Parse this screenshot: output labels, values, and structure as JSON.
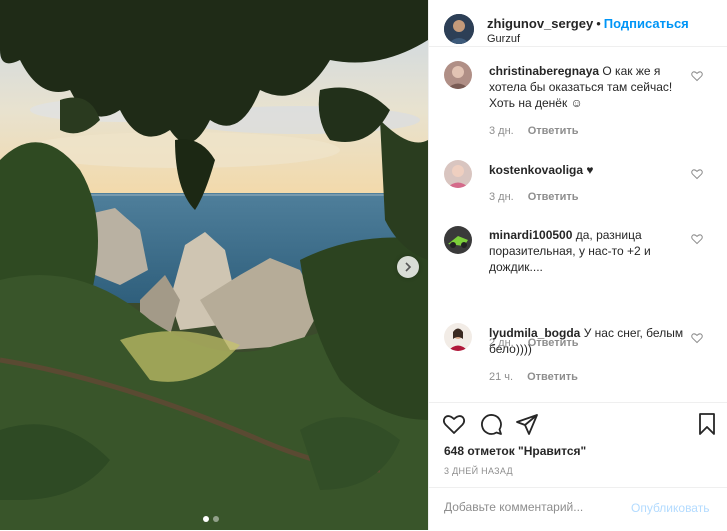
{
  "header": {
    "username": "zhigunov_sergey",
    "separator": "•",
    "follow_label": "Подписаться",
    "location": "Gurzuf",
    "avatar_icon": "user-avatar-icon"
  },
  "comments": [
    {
      "username": "christinaberegnaya",
      "text": "О как же я хотела бы оказаться там сейчас! Хоть на денёк ☺",
      "time": "3 дн.",
      "reply_label": "Ответить"
    },
    {
      "username": "kostenkovaoliga",
      "text": "♥",
      "time": "3 дн.",
      "reply_label": "Ответить"
    },
    {
      "username": "minardi100500",
      "text": "да, разница поразительная, у нас-то +2 и дождик....",
      "time": "2 дн.",
      "reply_label": "Ответить"
    },
    {
      "username": "lyudmila_bogda",
      "text": "У нас снег, белым бело))))",
      "time": "21 ч.",
      "reply_label": "Ответить"
    }
  ],
  "actions": {
    "likes_text": "648 отметок \"Нравится\"",
    "date": "3 ДНЕЙ НАЗАД",
    "icons": [
      "heart-icon",
      "comment-icon",
      "share-icon",
      "bookmark-icon"
    ]
  },
  "add_comment": {
    "placeholder": "Добавьте комментарий...",
    "publish_label": "Опубликовать"
  },
  "carousel": {
    "current": 1,
    "total": 2,
    "next_icon": "chevron-right-icon"
  },
  "colors": {
    "link": "#0095f6",
    "muted": "#8e8e8e",
    "publish_disabled": "#b3dbff",
    "border": "#efefef"
  }
}
